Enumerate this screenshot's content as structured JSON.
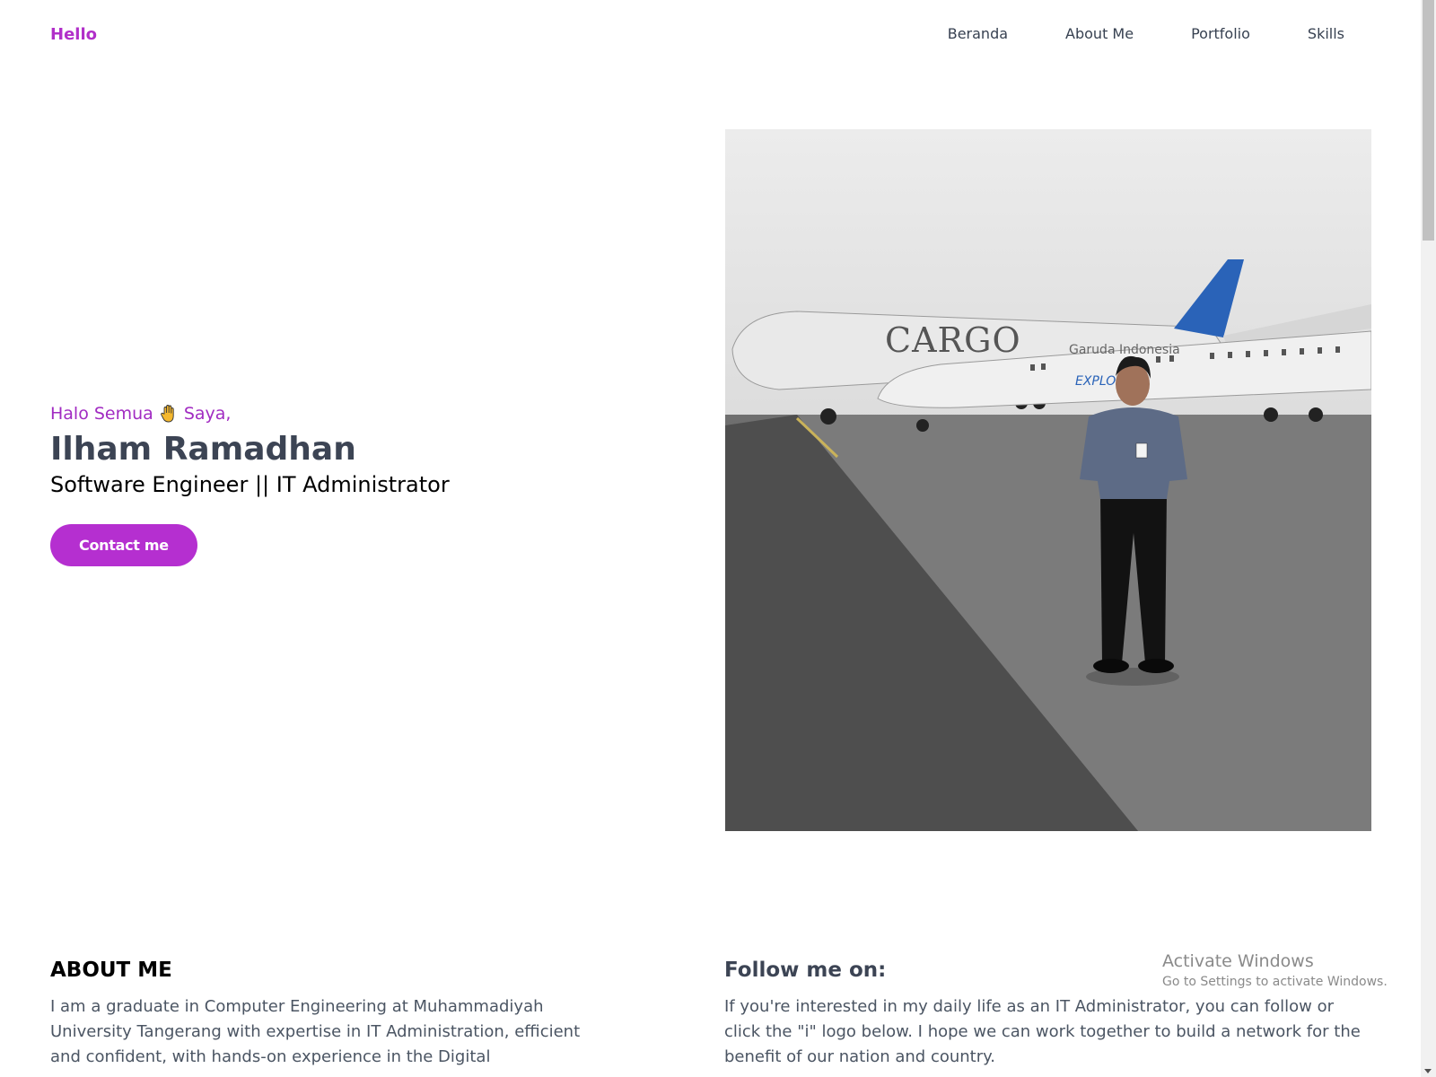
{
  "nav": {
    "brand": "Hello",
    "links": [
      {
        "label": "Beranda"
      },
      {
        "label": "About Me"
      },
      {
        "label": "Portfolio"
      },
      {
        "label": "Skills"
      }
    ]
  },
  "hero": {
    "greeting_prefix": "Halo Semua",
    "greeting_icon": "raised-hand-icon",
    "greeting_suffix": "Saya,",
    "name": "Ilham Ramadhan",
    "role": "Software Engineer || IT Administrator",
    "cta_label": "Contact me"
  },
  "photo": {
    "alt": "Man standing in front of Garuda Indonesia aircraft on airport apron",
    "aircraft_text": "CARGO",
    "airline_text": "Garuda Indonesia",
    "explore_text": "EXPLORE"
  },
  "about": {
    "title": "ABOUT ME",
    "body": "I am a graduate in Computer Engineering at Muhammadiyah University Tangerang with expertise in IT Administration, efficient and confident, with hands-on experience in the Digital"
  },
  "follow": {
    "title": "Follow me on:",
    "body": "If you're interested in my daily life as an IT Administrator, you can follow or click the \"i\" logo below. I hope we can work together to build a network for the benefit of our nation and country."
  },
  "watermark": {
    "title": "Activate Windows",
    "subtitle": "Go to Settings to activate Windows."
  },
  "colors": {
    "accent": "#b52fd0",
    "greeting": "#a12bc2",
    "heading": "#3c4454",
    "body": "#4b5563"
  }
}
